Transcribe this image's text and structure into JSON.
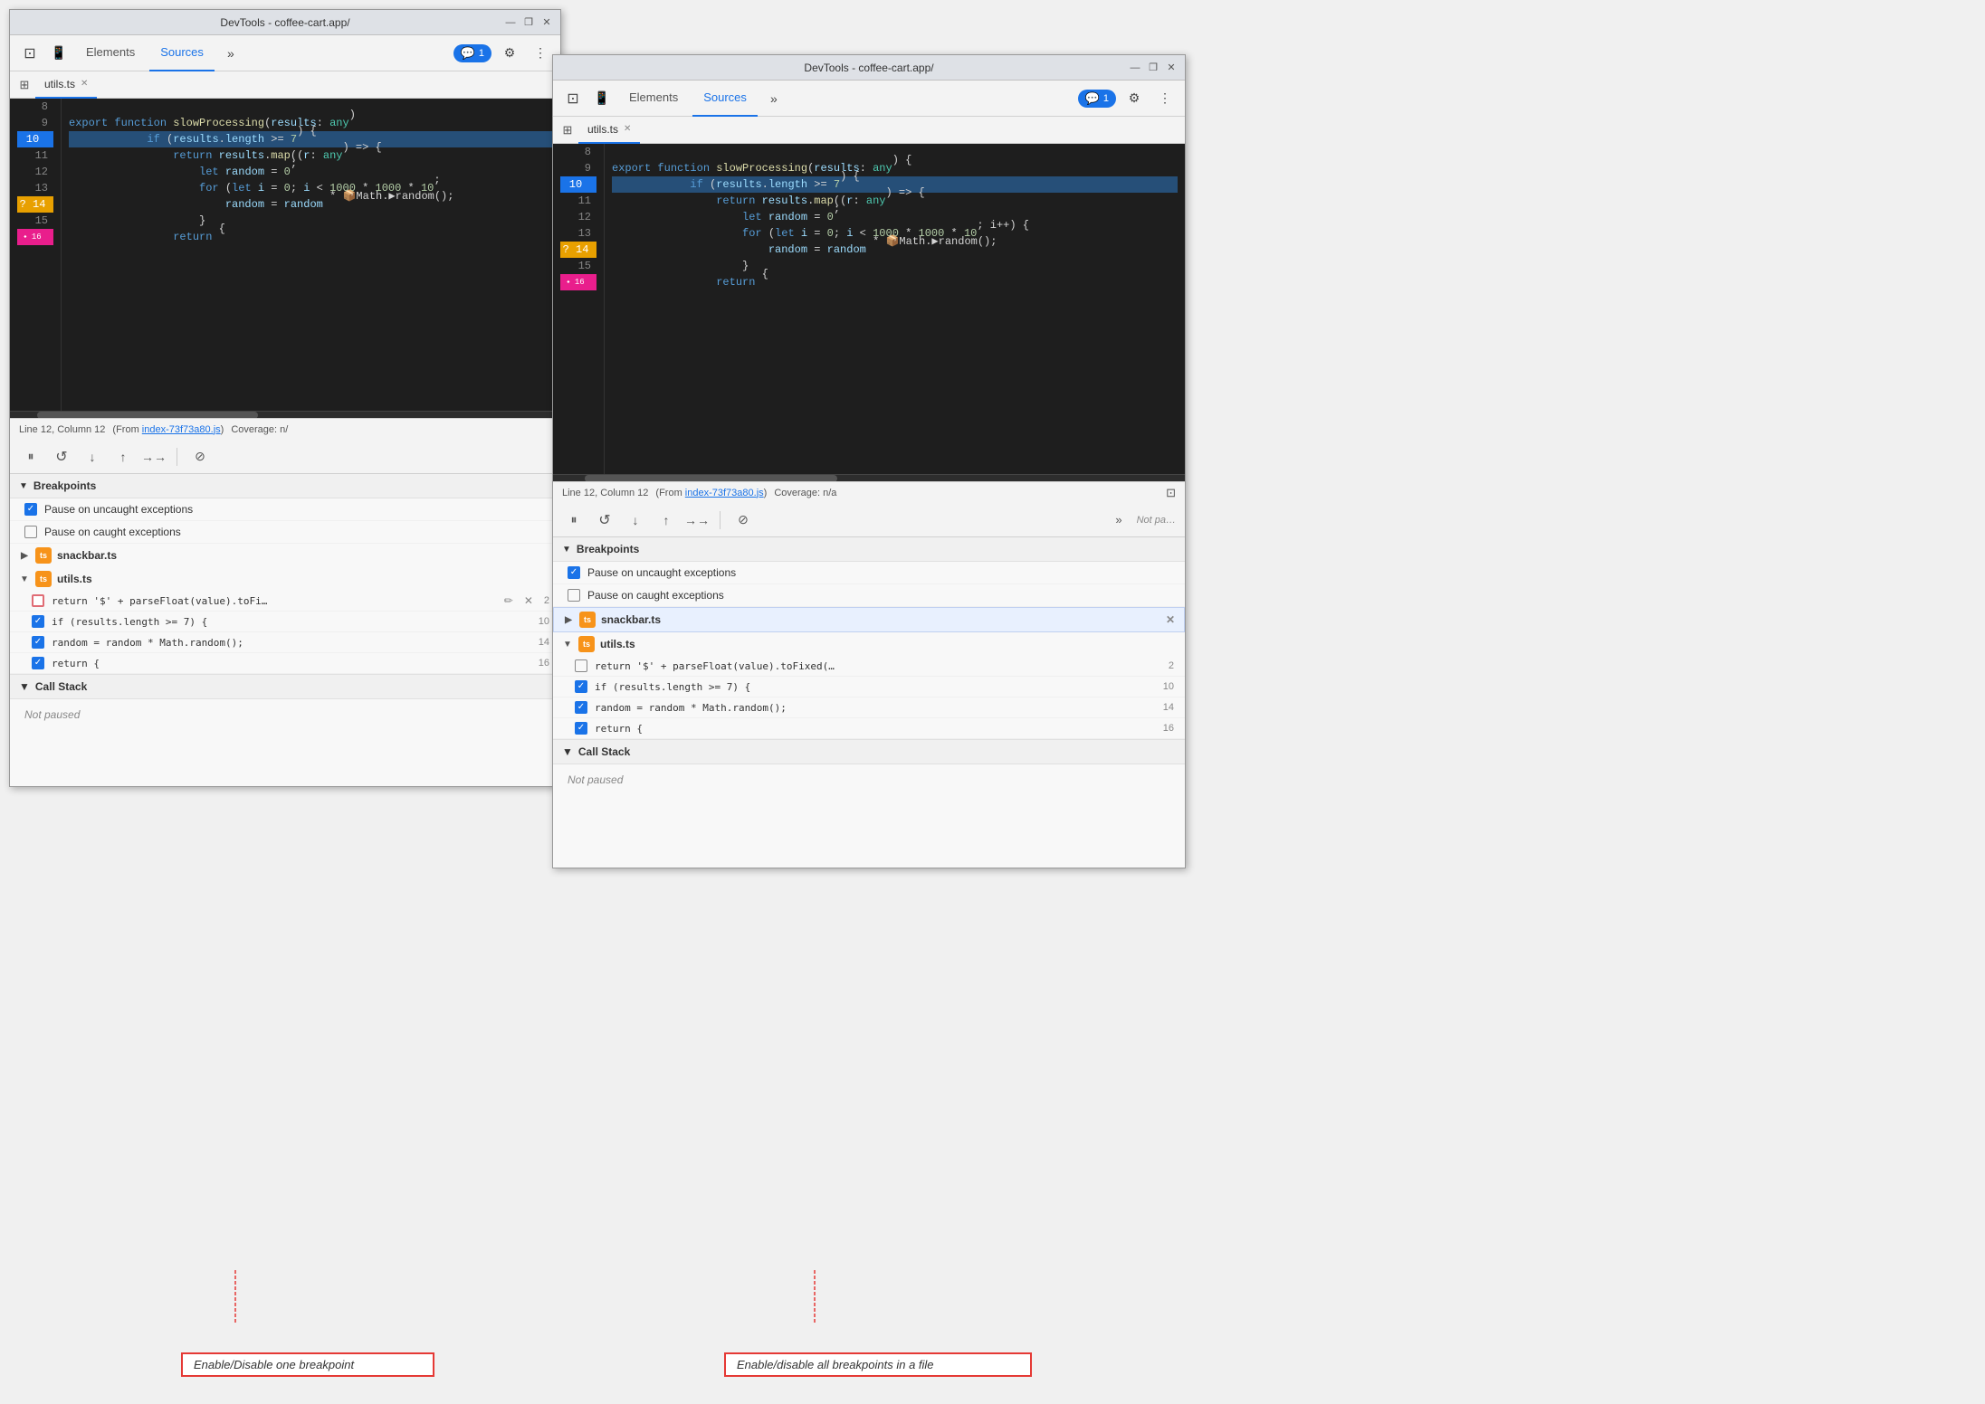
{
  "window1": {
    "title": "DevTools - coffee-cart.app/",
    "tabs": [
      "Elements",
      "Sources"
    ],
    "activeTab": "Sources",
    "fileTab": "utils.ts",
    "consoleBadge": "1",
    "codeLines": [
      {
        "num": "8",
        "content": "",
        "highlight": false
      },
      {
        "num": "9",
        "content": "export function slowProcessing(results: any)",
        "highlight": false
      },
      {
        "num": "10",
        "content": "    if (results.length >= 7) {",
        "highlight": true,
        "type": "active"
      },
      {
        "num": "11",
        "content": "        return results.map((r: any) => {",
        "highlight": false
      },
      {
        "num": "12",
        "content": "            let random = 0;",
        "highlight": false
      },
      {
        "num": "13",
        "content": "            for (let i = 0; i < 1000 * 1000 * 10;",
        "highlight": false
      },
      {
        "num": "14",
        "content": "                random = random * 📦Math.▶random();",
        "highlight": false,
        "type": "question"
      },
      {
        "num": "15",
        "content": "            }",
        "highlight": false
      },
      {
        "num": "16",
        "content": "        return {",
        "highlight": false,
        "type": "pink"
      }
    ],
    "statusBar": {
      "position": "Line 12, Column 12",
      "from": "(From index-73f73a80.js)",
      "coverage": "Coverage: n/"
    },
    "breakpoints": {
      "title": "Breakpoints",
      "items": [
        {
          "type": "checkbox",
          "checked": true,
          "label": "Pause on uncaught exceptions"
        },
        {
          "type": "checkbox",
          "checked": false,
          "label": "Pause on caught exceptions"
        }
      ],
      "files": [
        {
          "name": "snackbar.ts",
          "expanded": false,
          "items": []
        },
        {
          "name": "utils.ts",
          "expanded": true,
          "items": [
            {
              "label": "return '$' + parseFloat(value).toFi…",
              "line": "2",
              "checked": false,
              "redBorder": true
            },
            {
              "label": "if (results.length >= 7) {",
              "line": "10",
              "checked": true
            },
            {
              "label": "random = random * Math.random();",
              "line": "14",
              "checked": true
            },
            {
              "label": "return {",
              "line": "16",
              "checked": true
            }
          ]
        }
      ]
    },
    "callStack": {
      "title": "Call Stack",
      "content": "Not paused"
    }
  },
  "window2": {
    "title": "DevTools - coffee-cart.app/",
    "tabs": [
      "Elements",
      "Sources"
    ],
    "activeTab": "Sources",
    "fileTab": "utils.ts",
    "consoleBadge": "1",
    "codeLines": [
      {
        "num": "8",
        "content": "",
        "highlight": false
      },
      {
        "num": "9",
        "content": "export function slowProcessing(results: any) {",
        "highlight": false
      },
      {
        "num": "10",
        "content": "    if (results.length >= 7) {",
        "highlight": true,
        "type": "active"
      },
      {
        "num": "11",
        "content": "        return results.map((r: any) => {",
        "highlight": false
      },
      {
        "num": "12",
        "content": "            let random = 0;",
        "highlight": false
      },
      {
        "num": "13",
        "content": "            for (let i = 0; i < 1000 * 1000 * 10; i++) {",
        "highlight": false
      },
      {
        "num": "14",
        "content": "                random = random * 📦Math.▶random();",
        "highlight": false,
        "type": "question"
      },
      {
        "num": "15",
        "content": "            }",
        "highlight": false
      },
      {
        "num": "16",
        "content": "        return {",
        "highlight": false,
        "type": "pink"
      }
    ],
    "statusBar": {
      "position": "Line 12, Column 12",
      "from": "(From index-73f73a80.js)",
      "coverage": "Coverage: n/a"
    },
    "breakpoints": {
      "title": "Breakpoints",
      "items": [
        {
          "type": "checkbox",
          "checked": true,
          "label": "Pause on uncaught exceptions"
        },
        {
          "type": "checkbox",
          "checked": false,
          "label": "Pause on caught exceptions"
        }
      ],
      "files": [
        {
          "name": "snackbar.ts",
          "expanded": false,
          "highlighted": true,
          "items": []
        },
        {
          "name": "utils.ts",
          "expanded": true,
          "items": [
            {
              "label": "return '$' + parseFloat(value).toFixed(…",
              "line": "2",
              "checked": false
            },
            {
              "label": "if (results.length >= 7) {",
              "line": "10",
              "checked": true
            },
            {
              "label": "random = random * Math.random();",
              "line": "14",
              "checked": true
            },
            {
              "label": "return {",
              "line": "16",
              "checked": true
            }
          ]
        }
      ]
    },
    "callStack": {
      "title": "Call Stack",
      "content": "Not paused"
    }
  },
  "annotations": {
    "left": "Enable/Disable one breakpoint",
    "right": "Enable/disable all breakpoints in a file"
  },
  "icons": {
    "pause": "⏸",
    "stepOver": "↺",
    "stepInto": "↓",
    "stepOut": "↑",
    "resume": "→→",
    "deactivate": "⊘",
    "chevronDown": "▼",
    "chevronRight": "▶",
    "close": "×",
    "settings": "⚙",
    "more": "⋮",
    "sidebar": "⊞",
    "inspect": "⊡",
    "device": "📱"
  }
}
